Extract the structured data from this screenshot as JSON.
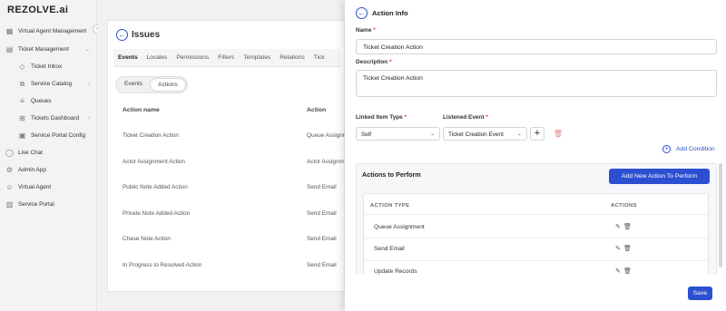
{
  "sidebar": {
    "logo": "REZOLVE.ai",
    "items": [
      {
        "label": "Virtual Agent Management",
        "icon": "grid-icon",
        "chevron": "›"
      },
      {
        "label": "Ticket Management",
        "icon": "ticket-icon",
        "chevron": "⌄"
      },
      {
        "label": "Ticket Inbox",
        "icon": "tag-icon",
        "chevron": ""
      },
      {
        "label": "Service Catalog",
        "icon": "stack-icon",
        "chevron": "›"
      },
      {
        "label": "Queues",
        "icon": "list-icon",
        "chevron": ""
      },
      {
        "label": "Tickets Dashboard",
        "icon": "dashboard-icon",
        "chevron": "›"
      },
      {
        "label": "Service Portal Config",
        "icon": "config-icon",
        "chevron": ""
      },
      {
        "label": "Live Chat",
        "icon": "chat-icon",
        "chevron": ""
      },
      {
        "label": "Admin App",
        "icon": "admin-icon",
        "chevron": ""
      },
      {
        "label": "Virtual Agent",
        "icon": "agent-icon",
        "chevron": ""
      },
      {
        "label": "Service Portal",
        "icon": "portal-icon",
        "chevron": ""
      }
    ]
  },
  "main": {
    "title": "Issues",
    "tabs": [
      "Events",
      "Locales",
      "Permissions",
      "Filters",
      "Templates",
      "Relations",
      "Tick"
    ],
    "pills": [
      "Events",
      "Actions"
    ],
    "columns": {
      "name": "Action name",
      "action": "Action"
    },
    "rows": [
      {
        "name": "Ticket Creation Action",
        "action": "Queue Assignm"
      },
      {
        "name": "Actor Assignment Action",
        "action": "Actor Assignm"
      },
      {
        "name": "Public Note Added Action",
        "action": "Send Email"
      },
      {
        "name": "Private Note Added Action",
        "action": "Send Email"
      },
      {
        "name": "Chase Note Action",
        "action": "Send Email"
      },
      {
        "name": "In Progress to Resolved Action",
        "action": "Send Email"
      }
    ]
  },
  "drawer": {
    "title": "Action Info",
    "name_label": "Name",
    "name_value": "Ticket Creation Action",
    "description_label": "Description",
    "description_value": "Ticket Creation Action",
    "linked_item_label": "Linked Item Type",
    "linked_item_value": "Self",
    "listened_event_label": "Listened Event",
    "listened_event_value": "Ticket Creation Event",
    "required_mark": "*",
    "add_condition_label": "Add Condition",
    "actions_panel_title": "Actions to Perform",
    "add_action_button": "Add New Action To Perform",
    "table_headers": {
      "type": "ACTION TYPE",
      "actions": "ACTIONS"
    },
    "action_rows": [
      "Queue Assignment",
      "Send Email",
      "Update Records"
    ],
    "save_label": "Save"
  },
  "colors": {
    "accent": "#2c4fd1",
    "danger": "#e58a8a"
  }
}
